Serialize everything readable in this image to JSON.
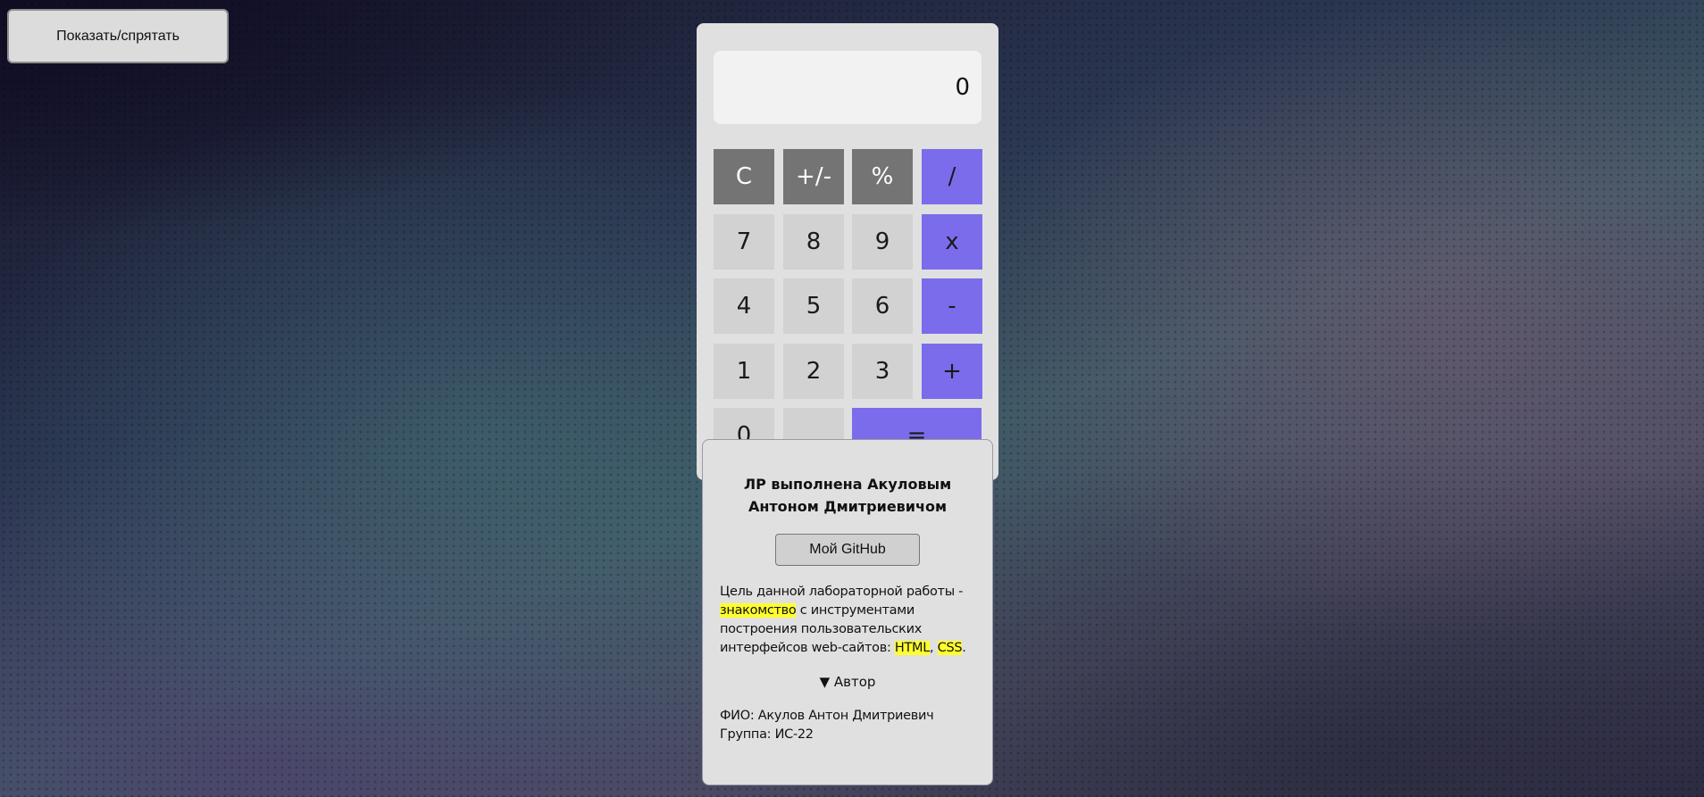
{
  "toggle_button": {
    "label": "Показать/спрятать"
  },
  "calculator": {
    "display_value": "0",
    "keys": {
      "clear": "C",
      "sign": "+/-",
      "percent": "%",
      "divide": "/",
      "seven": "7",
      "eight": "8",
      "nine": "9",
      "multiply": "x",
      "four": "4",
      "five": "5",
      "six": "6",
      "minus": "-",
      "one": "1",
      "two": "2",
      "three": "3",
      "plus": "+",
      "zero": "0",
      "decimal": "",
      "equals": "="
    },
    "colors": {
      "function_key": "#747474",
      "operator_key": "#7b6cec",
      "number_key": "#d2d2d2"
    }
  },
  "info": {
    "title": "ЛР выполнена Акуловым Антоном Дмитриевичом",
    "github_label": "Мой GitHub",
    "goal": {
      "part1": "Цель данной лабораторной работы - ",
      "highlight1": "знакомство",
      "part2": " с инструментами построения пользовательских интерфейсов web-сайтов: ",
      "highlight2": "HTML",
      "part3": ", ",
      "highlight3": "CSS",
      "part4": "."
    },
    "details_arrow": "▼",
    "details_label": "Автор",
    "fio_line": "ФИО: Акулов Антон Дмитриевич",
    "group_line": "Группа: ИС-22",
    "highlight_color": "#ffff2e"
  }
}
